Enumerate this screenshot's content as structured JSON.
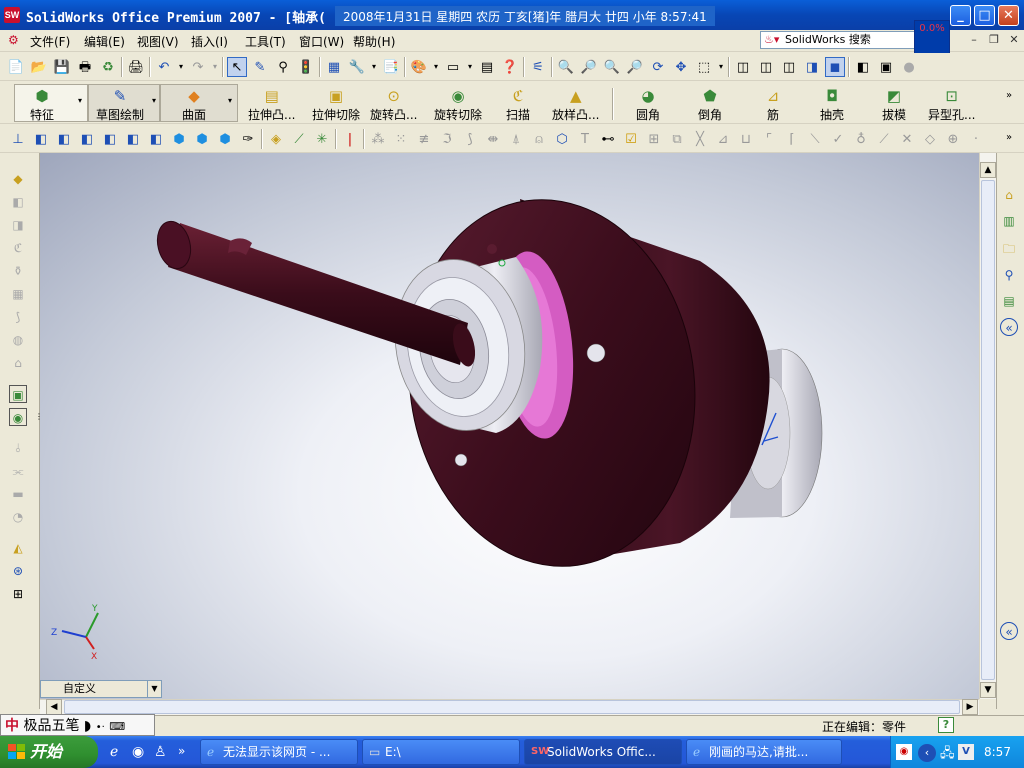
{
  "titlebar": {
    "text": "SolidWorks Office Premium 2007 - [轴承(",
    "clock": "2008年1月31日 星期四 农历 丁亥[猪]年 腊月大 廿四 小年   8:57:41",
    "progress": "0.0%"
  },
  "menu": {
    "items": [
      "文件(F)",
      "编辑(E)",
      "视图(V)",
      "插入(I)",
      "工具(T)",
      "窗口(W)",
      "帮助(H)"
    ],
    "search_placeholder": "SolidWorks 搜索"
  },
  "commands": {
    "feature": "特征",
    "sketch": "草图绘制",
    "surface": "曲面",
    "extrude_boss": "拉伸凸...",
    "extrude_cut": "拉伸切除",
    "revolve_boss": "旋转凸...",
    "revolve_cut": "旋转切除",
    "sweep": "扫描",
    "loft_boss": "放样凸...",
    "fillet": "圆角",
    "chamfer": "倒角",
    "rib": "筋",
    "shell": "抽壳",
    "draft": "拔模",
    "hole_wizard": "异型孔..."
  },
  "viewport": {
    "view_dropdown": "自定义",
    "triad": {
      "x": "X",
      "y": "Y",
      "z": "Z"
    }
  },
  "status": {
    "text": "正在编辑：零件",
    "ime": "极品五笔"
  },
  "taskbar": {
    "start": "开始",
    "tasks": [
      "无法显示该网页 - ...",
      "E:\\",
      "SolidWorks Offic...",
      "刚画的马达,请批..."
    ],
    "clock": "8:57"
  },
  "colors": {
    "housing": "#3b0d1c",
    "bearing": "#c8c8d0",
    "pink": "#e678d6",
    "title_blue": "#0a56d0"
  }
}
